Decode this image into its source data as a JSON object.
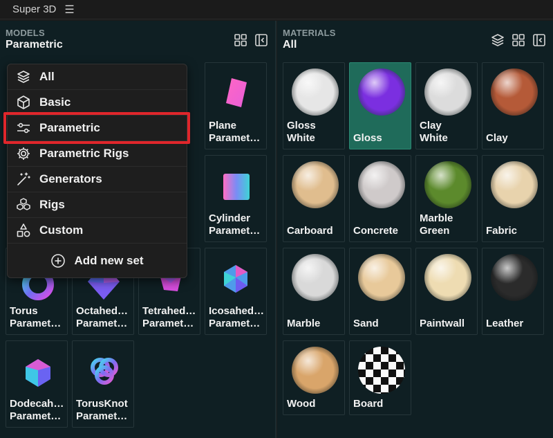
{
  "app": {
    "title": "Super 3D"
  },
  "models": {
    "header_label": "MODELS",
    "header_value": "Parametric",
    "header_icons": [
      "grid-view-icon",
      "collapse-panel-icon"
    ],
    "cards": [
      {
        "label": "Plane\nParamet…",
        "icon": "plane-shape-icon"
      },
      {
        "label": "Cylinder\nParamet…",
        "icon": "cylinder-shape-icon"
      },
      {
        "label": "Torus\nParamet…",
        "icon": "torus-shape-icon"
      },
      {
        "label": "Octahed…\nParamet…",
        "icon": "octahedron-shape-icon"
      },
      {
        "label": "Tetrahed…\nParamet…",
        "icon": "tetrahedron-shape-icon"
      },
      {
        "label": "Icosahed…\nParamet…",
        "icon": "icosahedron-shape-icon"
      },
      {
        "label": "Dodecah…\nParamet…",
        "icon": "dodecahedron-shape-icon"
      },
      {
        "label": "TorusKnot\nParamet…",
        "icon": "torusknot-shape-icon"
      }
    ]
  },
  "dropdown": {
    "items": [
      {
        "label": "All",
        "icon": "layers-icon"
      },
      {
        "label": "Basic",
        "icon": "cube-icon"
      },
      {
        "label": "Parametric",
        "icon": "sliders-icon",
        "highlighted": true
      },
      {
        "label": "Parametric Rigs",
        "icon": "gear-icon"
      },
      {
        "label": "Generators",
        "icon": "magic-wand-icon"
      },
      {
        "label": "Rigs",
        "icon": "cubes-icon"
      },
      {
        "label": "Custom",
        "icon": "shapes-icon"
      }
    ],
    "add_label": "Add new set"
  },
  "materials": {
    "header_label": "MATERIALS",
    "header_value": "All",
    "header_icons": [
      "layers-icon",
      "grid-view-icon",
      "collapse-panel-icon"
    ],
    "cards": [
      {
        "label": "Gloss\nWhite",
        "color": "#e6e6e6"
      },
      {
        "label": "Gloss",
        "color": "#7b2fe0",
        "selected": true
      },
      {
        "label": "Clay\nWhite",
        "color": "#dcdcdc"
      },
      {
        "label": "Clay",
        "color": "#b55a38"
      },
      {
        "label": "Carboard",
        "color": "#e0bd8e"
      },
      {
        "label": "Concrete",
        "color": "#cfcaca"
      },
      {
        "label": "Marble\nGreen",
        "color": "#5c8a2c"
      },
      {
        "label": "Fabric",
        "color": "#e8d3ad"
      },
      {
        "label": "Marble",
        "color": "#d9d9d9"
      },
      {
        "label": "Sand",
        "color": "#e8c99a"
      },
      {
        "label": "Paintwall",
        "color": "#eedcb2"
      },
      {
        "label": "Leather",
        "color": "#2b2b2b"
      },
      {
        "label": "Wood",
        "color": "#d9a56a"
      },
      {
        "label": "Board",
        "color": "#ffffff"
      }
    ]
  }
}
